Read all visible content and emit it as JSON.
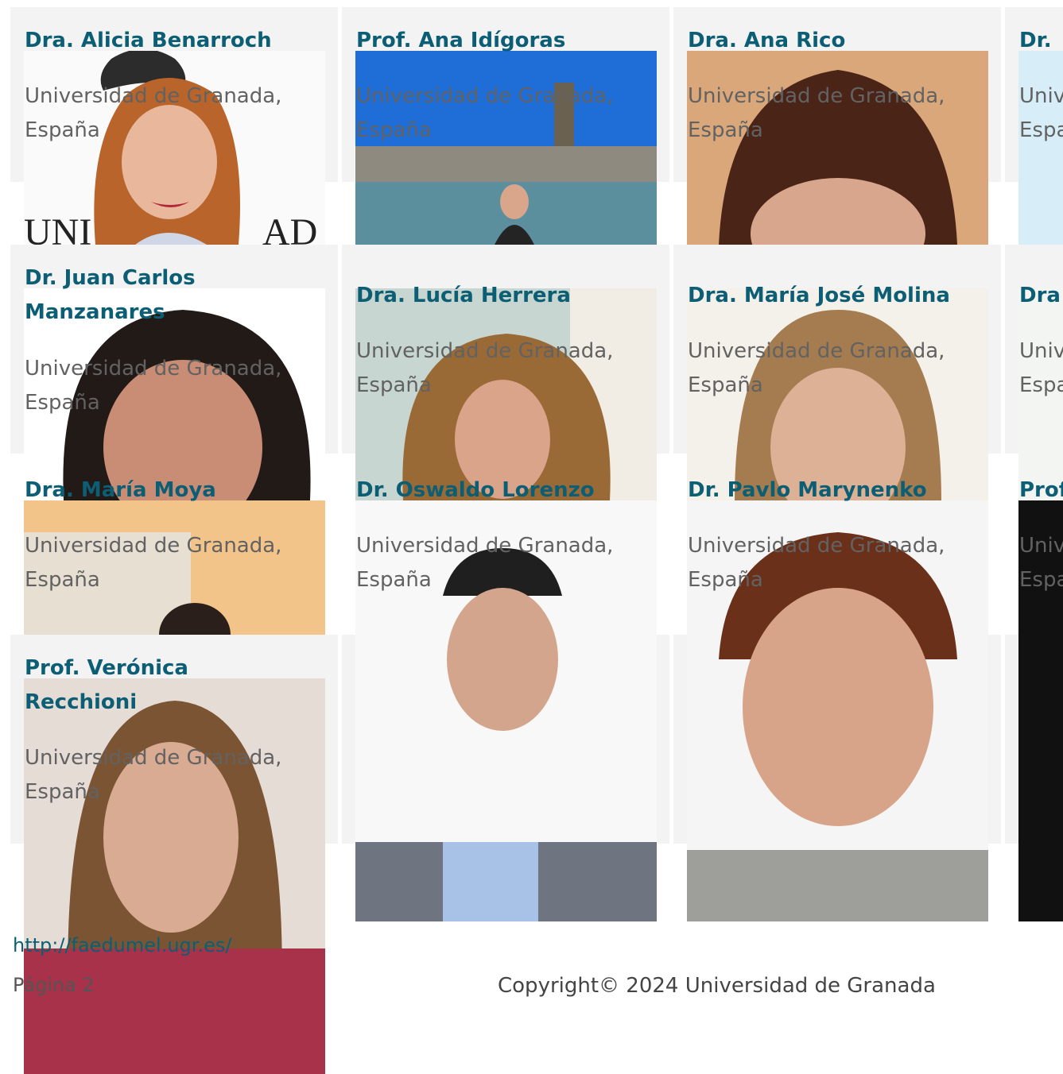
{
  "people": [
    {
      "name": "Dra. Alicia Benarroch",
      "affiliation": "Universidad de Granada, España"
    },
    {
      "name": "Prof. Ana Idígoras",
      "affiliation": "Universidad de Granada, España"
    },
    {
      "name": "Dra. Ana Rico",
      "affiliation": "Universidad de Granada, España"
    },
    {
      "name": "Dr.",
      "affiliation": "Univ Espa"
    },
    {
      "name": "Dr. Juan Carlos Manzanares",
      "affiliation": "Universidad de Granada, España"
    },
    {
      "name": "Dra. Lucía Herrera",
      "affiliation": "Universidad de Granada, España"
    },
    {
      "name": "Dra. María José Molina",
      "affiliation": "Universidad de Granada, España"
    },
    {
      "name": "Dra",
      "affiliation": "Univ Espa"
    },
    {
      "name": "Dra. María Moya",
      "affiliation": "Universidad de Granada, España"
    },
    {
      "name": "Dr. Oswaldo Lorenzo",
      "affiliation": "Universidad de Granada, España"
    },
    {
      "name": "Dr. Pavlo Marynenko",
      "affiliation": "Universidad de Granada, España"
    },
    {
      "name": "Prof",
      "affiliation": "Univ Espa"
    },
    {
      "name": "Prof. Verónica Recchioni",
      "affiliation": "Universidad de Granada, España"
    }
  ],
  "footer": {
    "link": "http://faedumel.ugr.es/",
    "page": "Página 2",
    "copyright": "Copyright© 2024 Universidad de Granada"
  }
}
